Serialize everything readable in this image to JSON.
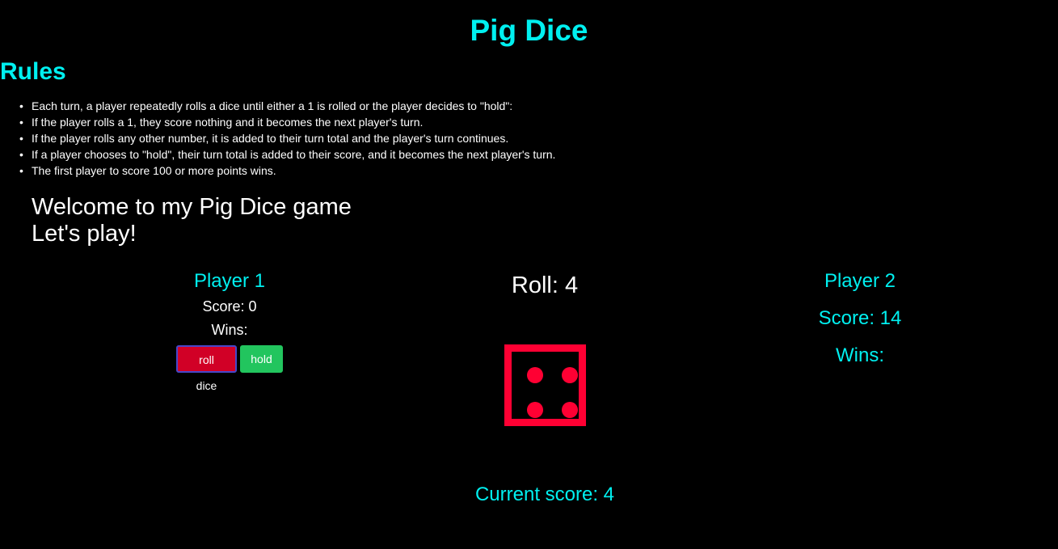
{
  "title": "Pig Dice",
  "rules": {
    "heading": "Rules",
    "items": [
      "Each turn, a player repeatedly rolls a dice until either a 1 is rolled or the player decides to \"hold\":",
      "If the player rolls a 1, they score nothing and it becomes the next player's turn.",
      "If the player rolls any other number, it is added to their turn total and the player's turn continues.",
      "If a player chooses to \"hold\", their turn total is added to their score, and it becomes the next player's turn.",
      "The first player to score 100 or more points wins."
    ]
  },
  "welcome": {
    "line1": "Welcome to my Pig Dice game",
    "line2": "Let's play!"
  },
  "player1": {
    "name": "Player 1",
    "score_text": "Score: 0",
    "wins_text": "Wins:",
    "roll_button": "roll dice",
    "hold_button": "hold"
  },
  "center": {
    "roll_text": "Roll: 4",
    "die_value": 4,
    "current_score_text": "Current score: 4"
  },
  "player2": {
    "name": "Player 2",
    "score_text": "Score: 14",
    "wins_text": "Wins:"
  },
  "colors": {
    "accent": "#00f0f0",
    "die": "#ff0033",
    "roll_button": "#d10026",
    "hold_button": "#22c55e",
    "background": "#000000"
  }
}
